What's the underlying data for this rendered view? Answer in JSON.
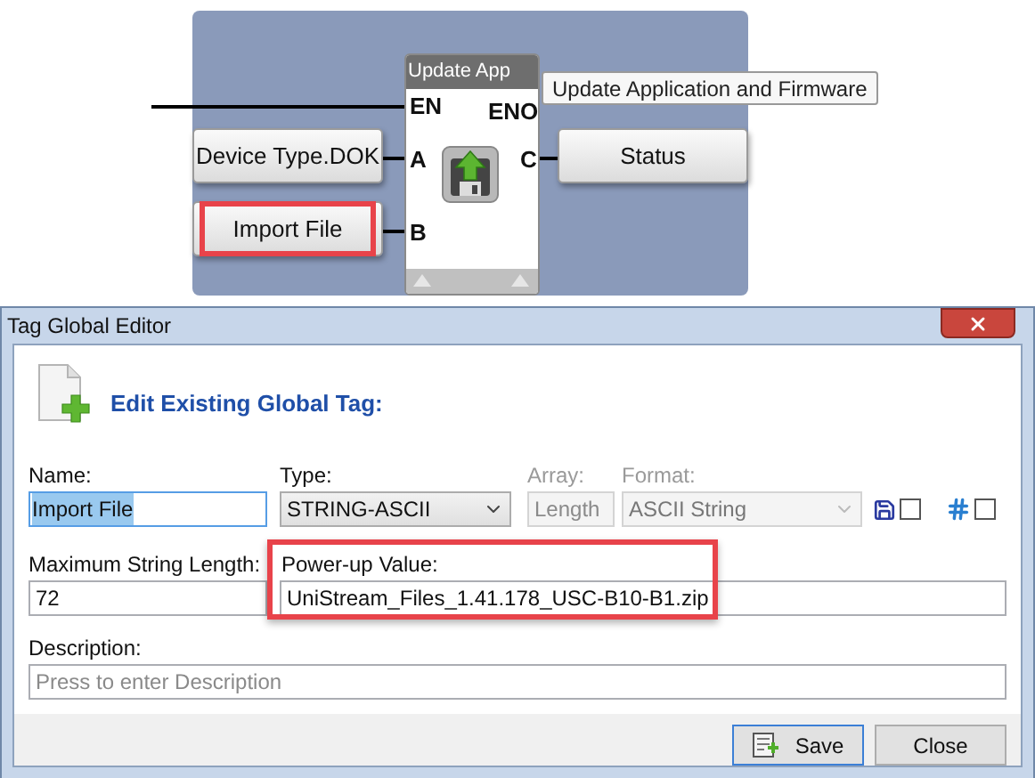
{
  "diagram": {
    "block": {
      "title": "Update App",
      "enable_in": "EN",
      "enable_out": "ENO",
      "tooltip": "Update Application and Firmware"
    },
    "inputs": [
      {
        "label": "Device Type.DOK",
        "pin": "A",
        "highlighted": false
      },
      {
        "label": "Import File",
        "pin": "B",
        "highlighted": true
      }
    ],
    "outputs": [
      {
        "label": "Status",
        "pin": "C",
        "highlighted": false
      }
    ]
  },
  "dialog": {
    "title": "Tag Global Editor",
    "heading": "Edit Existing Global Tag:",
    "name": {
      "label": "Name:",
      "value": "Import File",
      "text_selected": true
    },
    "type": {
      "label": "Type:",
      "value": "STRING-ASCII",
      "disabled": false
    },
    "array": {
      "label": "Array:",
      "placeholder": "Length",
      "disabled": true
    },
    "format": {
      "label": "Format:",
      "value": "ASCII String",
      "disabled": true
    },
    "toggles": [
      {
        "kind": "save",
        "checked": false
      },
      {
        "kind": "hash",
        "checked": false
      }
    ],
    "max_length": {
      "label": "Maximum String Length:",
      "value": "72"
    },
    "power_up": {
      "label": "Power-up Value:",
      "value": "UniStream_Files_1.41.178_USC-B10-B1.zip",
      "highlighted": true
    },
    "description": {
      "label": "Description:",
      "placeholder": "Press to enter Description"
    },
    "buttons": [
      {
        "label": "Save",
        "kind": "save",
        "default": true
      },
      {
        "label": "Close",
        "kind": "close",
        "default": false
      }
    ]
  }
}
